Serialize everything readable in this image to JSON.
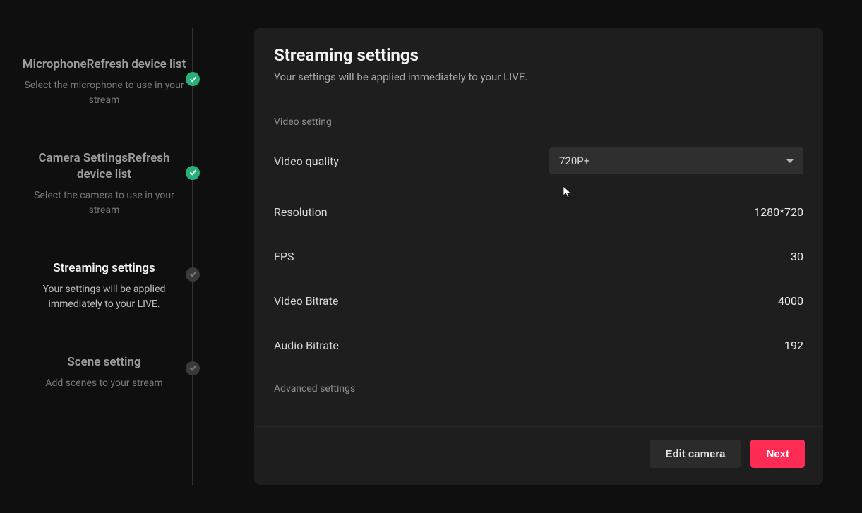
{
  "steps": [
    {
      "title": "MicrophoneRefresh device list",
      "desc": "Select the microphone to use in your stream",
      "status": "done"
    },
    {
      "title": "Camera SettingsRefresh device list",
      "desc": "Select the camera to use in your stream",
      "status": "done"
    },
    {
      "title": "Streaming settings",
      "desc": "Your settings will be applied immediately to your LIVE.",
      "status": "active-pending"
    },
    {
      "title": "Scene setting",
      "desc": "Add scenes to your stream",
      "status": "pending"
    }
  ],
  "panel": {
    "title": "Streaming settings",
    "subtitle": "Your settings will be applied immediately to your LIVE.",
    "video_section_label": "Video setting",
    "video_quality_label": "Video quality",
    "video_quality_value": "720P+",
    "rows": [
      {
        "label": "Resolution",
        "value": "1280*720"
      },
      {
        "label": "FPS",
        "value": "30"
      },
      {
        "label": "Video Bitrate",
        "value": "4000"
      },
      {
        "label": "Audio Bitrate",
        "value": "192"
      }
    ],
    "advanced_label": "Advanced settings"
  },
  "footer": {
    "edit_camera": "Edit camera",
    "next": "Next"
  }
}
